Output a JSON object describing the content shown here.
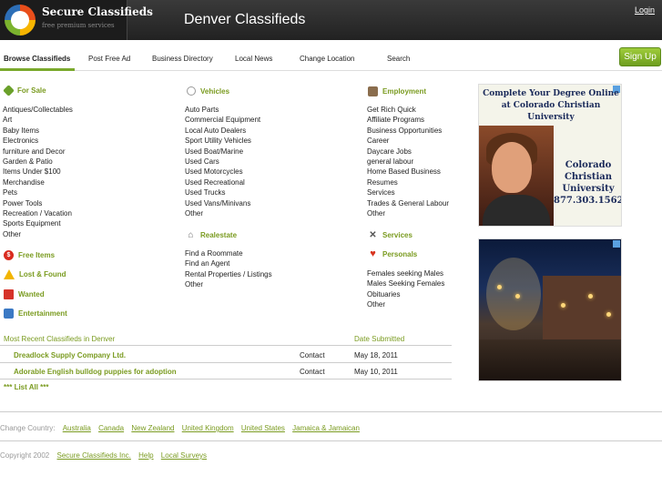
{
  "header": {
    "logo_name": "Secure Classifieds",
    "logo_tagline": "free premium services",
    "title": "Denver Classifieds",
    "login": "Login"
  },
  "nav": {
    "items": [
      "Browse Classifieds",
      "Post Free Ad",
      "Business Directory",
      "Local News",
      "Change Location",
      "Search"
    ],
    "signup": "Sign Up"
  },
  "categories": {
    "for_sale": {
      "title": "For Sale",
      "items": [
        "Antiques/Collectables",
        "Art",
        "Baby Items",
        "Electronics",
        "furniture and Decor",
        "Garden & Patio",
        "Items Under $100",
        "Merchandise",
        "Pets",
        "Power Tools",
        "Recreation / Vacation",
        "Sports Equipment",
        "Other"
      ]
    },
    "vehicles": {
      "title": "Vehicles",
      "items": [
        "Auto Parts",
        "Commercial Equipment",
        "Local Auto Dealers",
        "Sport Utility Vehicles",
        "Used Boat/Marine",
        "Used Cars",
        "Used Motorcycles",
        "Used Recreational",
        "Used Trucks",
        "Used Vans/Minivans",
        "Other"
      ]
    },
    "employment": {
      "title": "Employment",
      "items": [
        "Get Rich Quick",
        "Affiliate Programs",
        "Business Opportunities",
        "Career",
        "Daycare Jobs",
        "general labour",
        "Home Based Business",
        "Resumes",
        "Services",
        "Trades & General Labour",
        "Other"
      ]
    },
    "realestate": {
      "title": "Realestate",
      "items": [
        "Find a Roommate",
        "Find an Agent",
        "Rental Properties / Listings",
        "Other"
      ]
    },
    "services": {
      "title": "Services"
    },
    "personals": {
      "title": "Personals",
      "items": [
        "Females seeking Males",
        "Males Seeking Females",
        "Obituaries",
        "Other"
      ]
    },
    "free_items": {
      "title": "Free Items"
    },
    "lost_found": {
      "title": "Lost & Found"
    },
    "wanted": {
      "title": "Wanted"
    },
    "entertainment": {
      "title": "Entertainment"
    }
  },
  "recent": {
    "heading": "Most Recent Classifieds in Denver",
    "date_heading": "Date Submitted",
    "rows": [
      {
        "title": "Dreadlock Supply Company Ltd.",
        "contact": "Contact",
        "date": "May 18, 2011"
      },
      {
        "title": "Adorable English bulldog puppies for adoption",
        "contact": "Contact",
        "date": "May 10, 2011"
      }
    ],
    "list_all": "*** List All ***"
  },
  "footer": {
    "change_country_label": "Change Country:",
    "countries": [
      "Australia",
      "Canada",
      "New Zealand",
      "United Kingdom",
      "United States",
      "Jamaica & Jamaican"
    ],
    "copyright": "Copyright 2002",
    "links": [
      "Secure Classifieds Inc.",
      "Help",
      "Local Surveys"
    ]
  },
  "ads": {
    "ad1_headline": "Complete Your Degree Online at Colorado Christian University",
    "ad1_school": "Colorado Christian University",
    "ad1_phone": "877.303.1562"
  },
  "colors": {
    "accent": "#7a9b20",
    "header_bg": "#2a2a2a",
    "signup": "#8cbf33"
  }
}
